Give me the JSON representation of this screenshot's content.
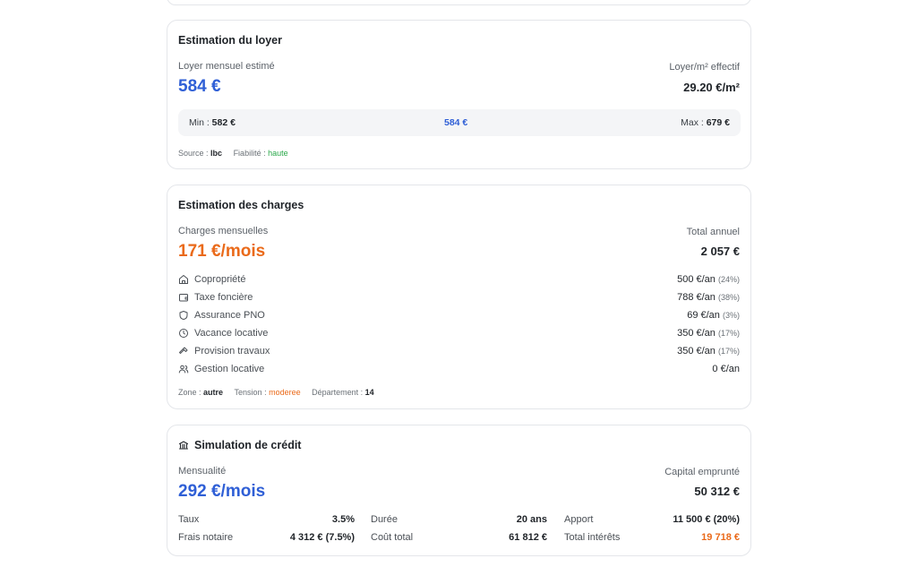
{
  "loyer": {
    "title": "Estimation du loyer",
    "monthly_label": "Loyer mensuel estimé",
    "monthly_value": "584 €",
    "effective_label": "Loyer/m² effectif",
    "effective_value": "29.20 €/m²",
    "range": {
      "min_label": "Min : ",
      "min_value": "582 €",
      "mid_value": "584 €",
      "max_label": "Max : ",
      "max_value": "679 €"
    },
    "source_label": "Source : ",
    "source_value": "lbc",
    "reliability_label": "Fiabilité : ",
    "reliability_value": "haute"
  },
  "charges": {
    "title": "Estimation des charges",
    "monthly_label": "Charges mensuelles",
    "monthly_value": "171 €/mois",
    "annual_label": "Total annuel",
    "annual_value": "2 057 €",
    "items": [
      {
        "icon": "home-icon",
        "label": "Copropriété",
        "value": "500 €/an",
        "pct": "(24%)"
      },
      {
        "icon": "wallet-icon",
        "label": "Taxe foncière",
        "value": "788 €/an",
        "pct": "(38%)"
      },
      {
        "icon": "shield-icon",
        "label": "Assurance PNO",
        "value": "69 €/an",
        "pct": "(3%)"
      },
      {
        "icon": "clock-icon",
        "label": "Vacance locative",
        "value": "350 €/an",
        "pct": "(17%)"
      },
      {
        "icon": "hammer-icon",
        "label": "Provision travaux",
        "value": "350 €/an",
        "pct": "(17%)"
      },
      {
        "icon": "users-icon",
        "label": "Gestion locative",
        "value": "0 €/an",
        "pct": ""
      }
    ],
    "zone_label": "Zone : ",
    "zone_value": "autre",
    "tension_label": "Tension : ",
    "tension_value": "moderee",
    "dept_label": "Département : ",
    "dept_value": "14"
  },
  "credit": {
    "title": "Simulation de crédit",
    "monthly_label": "Mensualité",
    "monthly_value": "292 €/mois",
    "capital_label": "Capital emprunté",
    "capital_value": "50 312 €",
    "taux_label": "Taux",
    "taux_value": "3.5%",
    "duree_label": "Durée",
    "duree_value": "20 ans",
    "apport_label": "Apport",
    "apport_value": "11 500 € (20%)",
    "notaire_label": "Frais notaire",
    "notaire_value": "4 312 € (7.5%)",
    "cout_label": "Coût total",
    "cout_value": "61 812 €",
    "interets_label": "Total intérêts",
    "interets_value": "19 718 €"
  },
  "colors": {
    "accent_blue": "#2f5fd6",
    "accent_orange": "#ea6a1a",
    "status_green": "#2aa84a"
  }
}
